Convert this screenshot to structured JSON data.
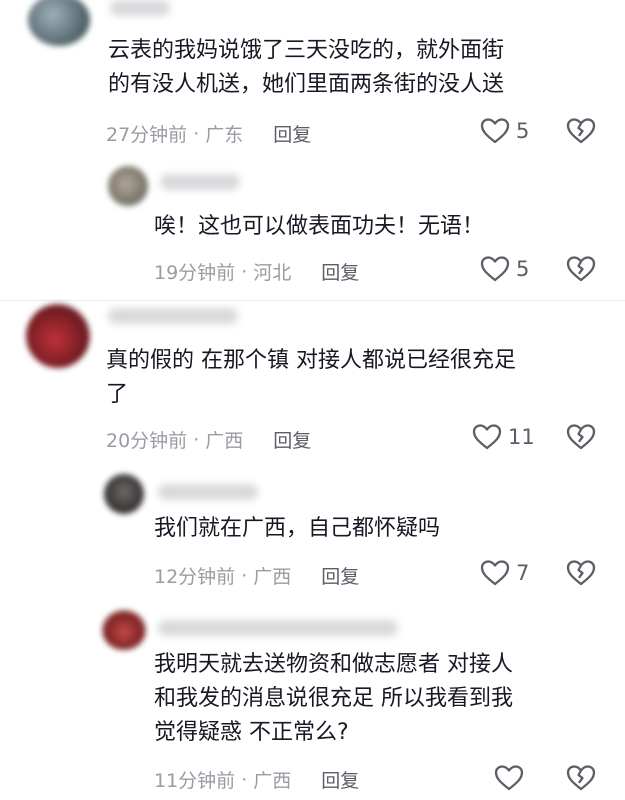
{
  "comments": [
    {
      "text": "云表的我妈说饿了三天没吃的，就外面街\n的有没人机送，她们里面两条街的没人送",
      "time": "27分钟前",
      "location": "广东",
      "reply_label": "回复",
      "likes": "5"
    },
    {
      "text": "唉！这也可以做表面功夫！无语！",
      "time": "19分钟前",
      "location": "河北",
      "reply_label": "回复",
      "likes": "5"
    },
    {
      "text": "真的假的 在那个镇 对接人都说已经很充足\n了",
      "time": "20分钟前",
      "location": "广西",
      "reply_label": "回复",
      "likes": "11"
    },
    {
      "text": "我们就在广西，自己都怀疑吗",
      "time": "12分钟前",
      "location": "广西",
      "reply_label": "回复",
      "likes": "7"
    },
    {
      "text": "我明天就去送物资和做志愿者 对接人\n和我发的消息说很充足 所以我看到我\n觉得疑惑 不正常么?",
      "time": "11分钟前",
      "location": "广西",
      "reply_label": "回复",
      "likes": ""
    }
  ],
  "meta_separator": "·",
  "icons": {
    "like": "heart-outline-icon",
    "dislike": "broken-heart-icon"
  },
  "colors": {
    "text": "#161823",
    "meta": "#9a9ba3",
    "action": "#5c5d66"
  }
}
